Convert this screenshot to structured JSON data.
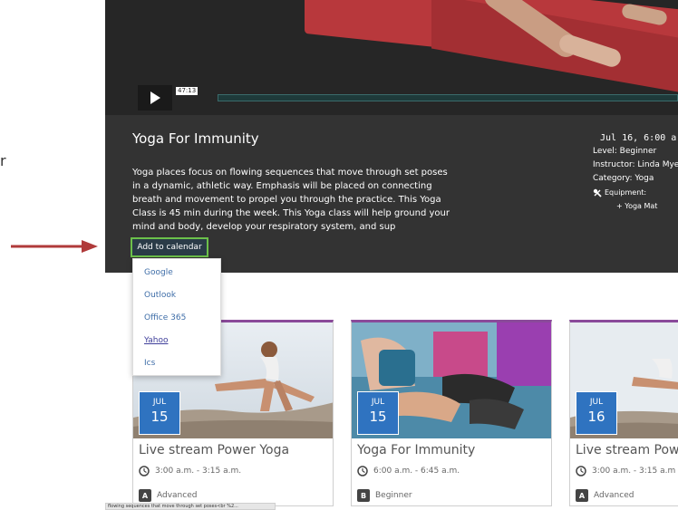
{
  "page": {
    "left_edge_letter": "r"
  },
  "video": {
    "time": "47:13"
  },
  "event": {
    "title": "Yoga For Immunity",
    "description": "Yoga places focus on flowing sequences that move through set poses in a dynamic, athletic way. Emphasis will be placed on connecting breath and movement to propel you through the practice. This Yoga Class is 45 min during the week. This Yoga class will help ground your mind and body, develop your respiratory system, and sup",
    "date": "Jul 16, 6:00 a.m",
    "level": "Level: Beginner",
    "instructor": "Instructor: Linda Mye",
    "category": "Category: Yoga",
    "equipment_label": "Equipment:",
    "equipment_item": "+ Yoga Mat"
  },
  "calendar": {
    "button_label": "Add to calendar",
    "options": [
      "Google",
      "Outlook",
      "Office 365",
      "Yahoo",
      "Ics"
    ]
  },
  "cards": [
    {
      "month": "JUL",
      "day": "15",
      "title": "Live stream Power Yoga",
      "time": "3:00 a.m. - 3:15 a.m.",
      "level_letter": "A",
      "level": "Advanced"
    },
    {
      "month": "JUL",
      "day": "15",
      "title": "Yoga For Immunity",
      "time": "6:00 a.m. - 6:45 a.m.",
      "level_letter": "B",
      "level": "Beginner"
    },
    {
      "month": "JUL",
      "day": "16",
      "title": "Live stream Pow",
      "time": "3:00 a.m. - 3:15 a.m",
      "level_letter": "A",
      "level": "Advanced"
    }
  ],
  "status_bar": {
    "text": "flowing sequences that move through set poses<br %2..."
  },
  "colors": {
    "accent_purple": "#8a4a9a",
    "date_badge_blue": "#2f73c0",
    "button_border_green": "#6cc04a",
    "arrow_red": "#b03a3a"
  }
}
